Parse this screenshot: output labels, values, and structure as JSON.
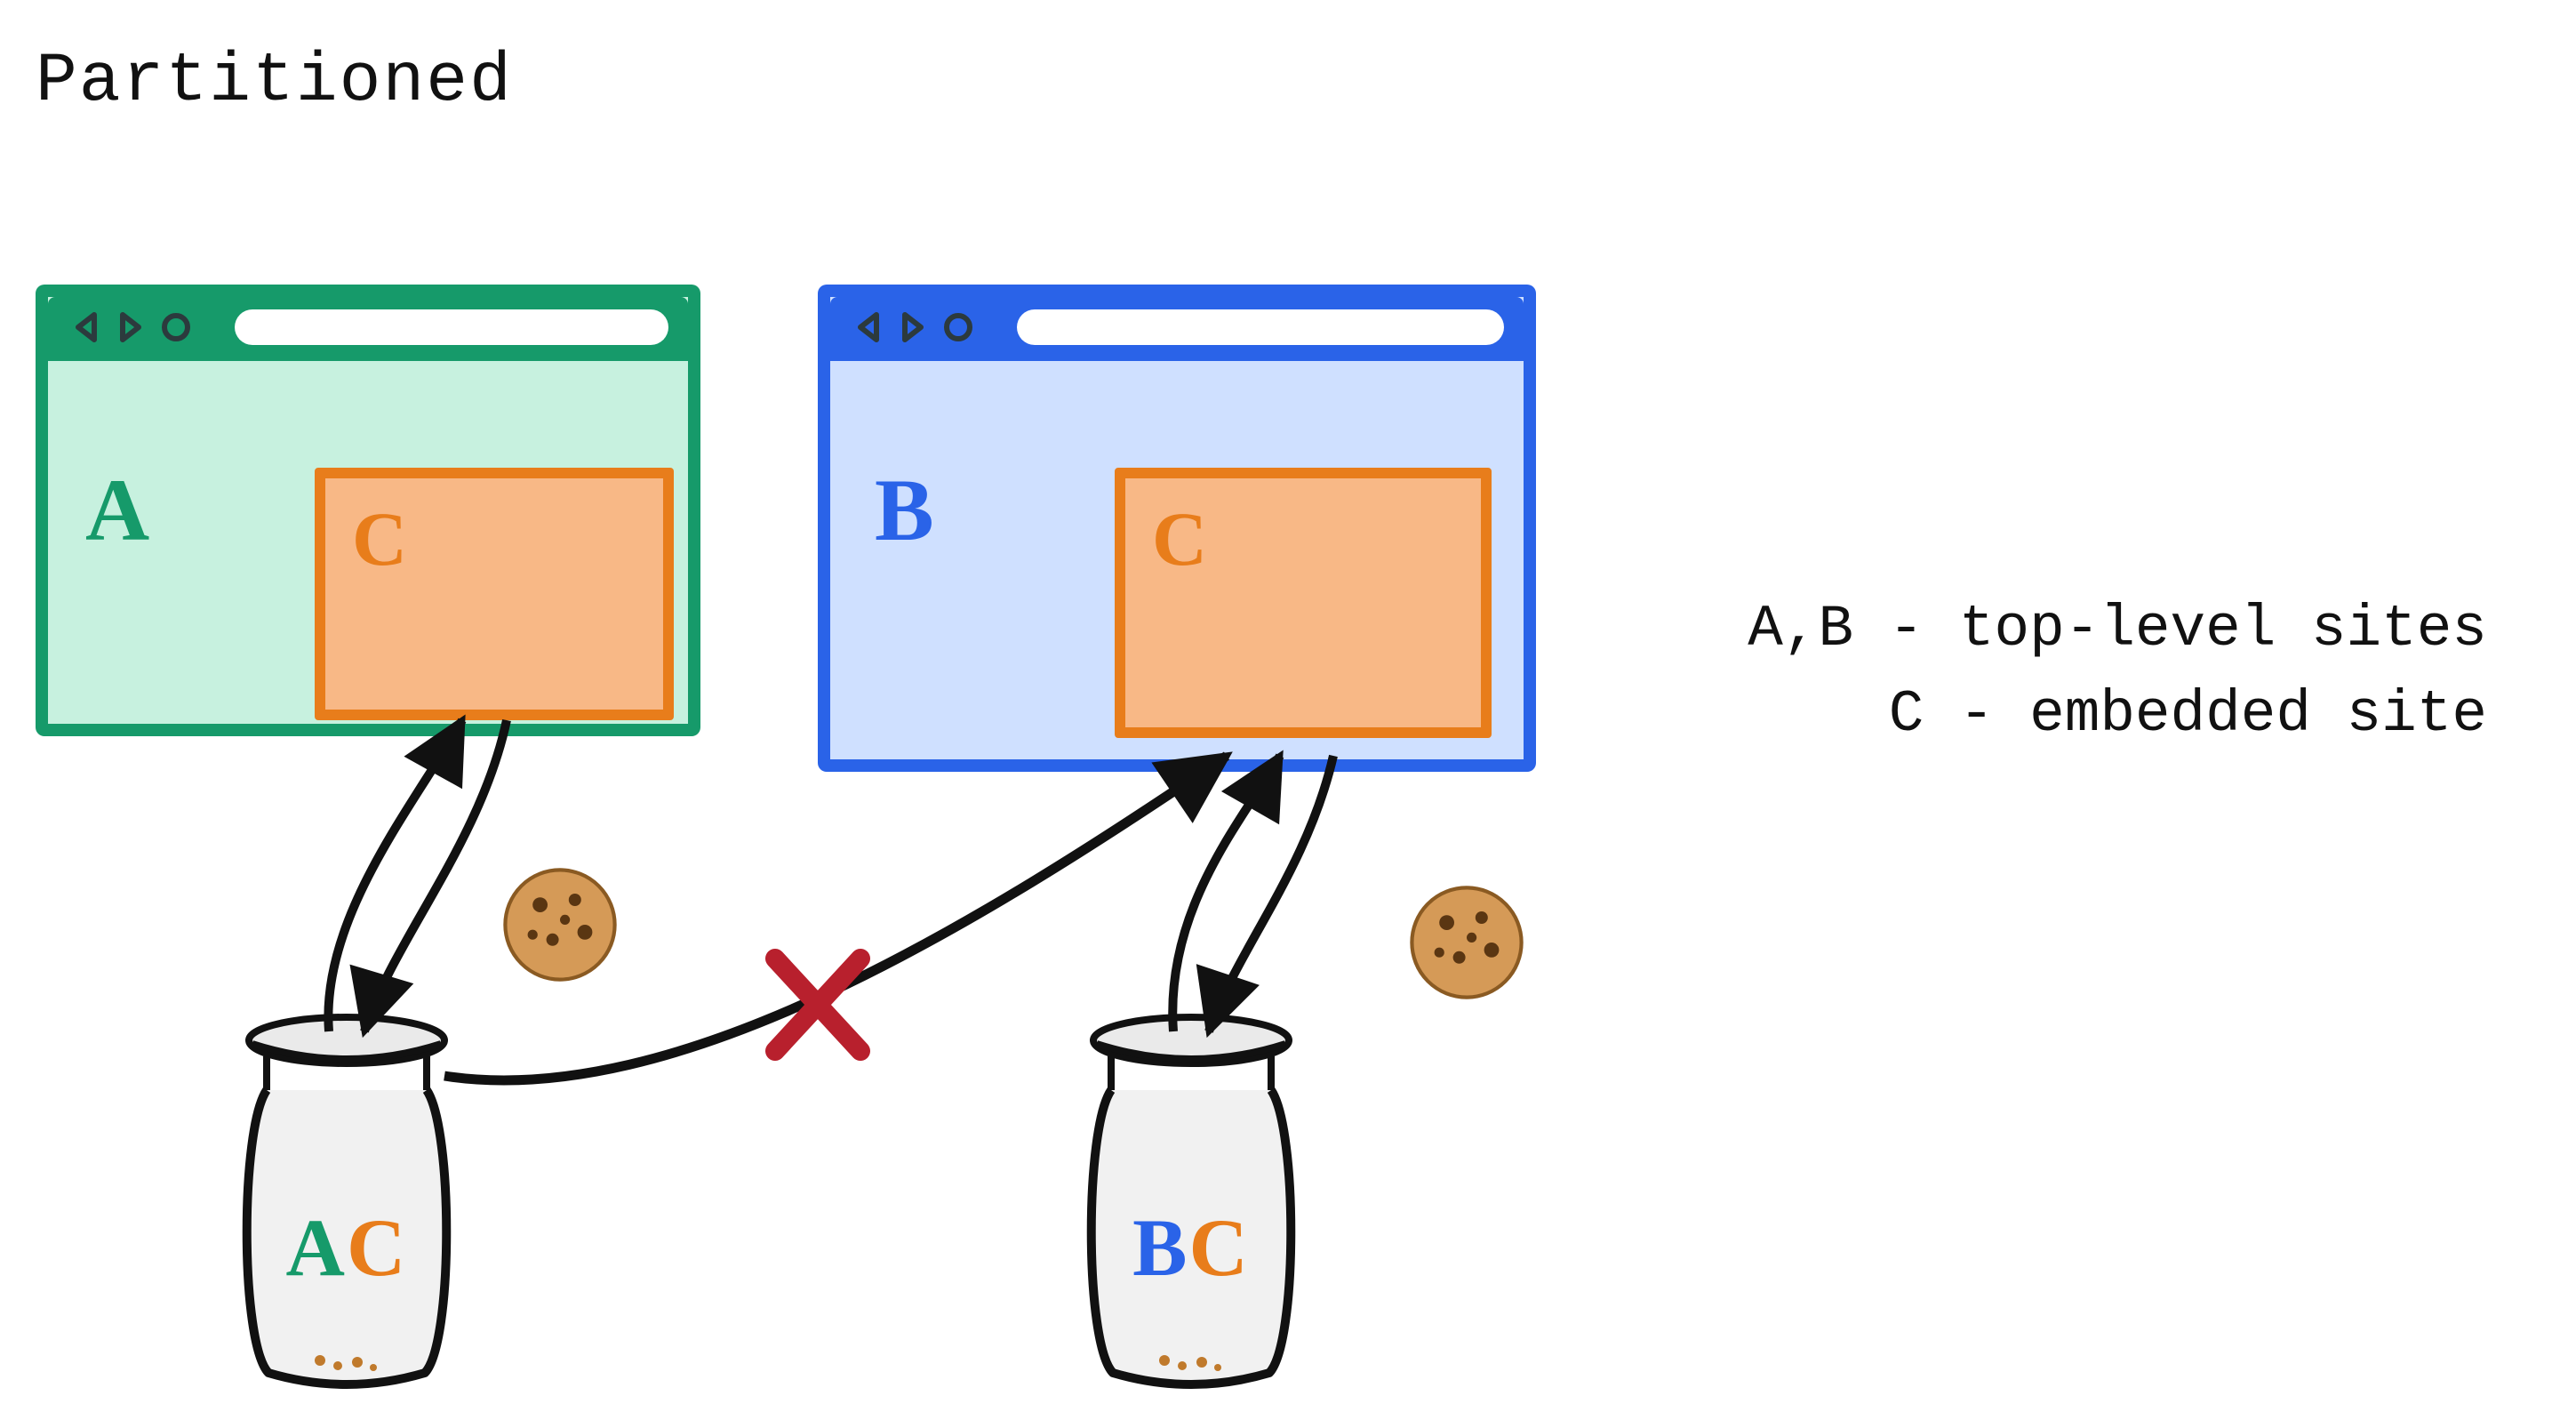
{
  "title": "Partitioned",
  "legend": {
    "line1": "A,B - top-level sites",
    "line2": "C - embedded site"
  },
  "windows": {
    "A": {
      "siteLabel": "A",
      "embedLabel": "C",
      "color": "#169a6a"
    },
    "B": {
      "siteLabel": "B",
      "embedLabel": "C",
      "color": "#2a63e8"
    }
  },
  "jars": {
    "A": {
      "part1": "A",
      "part2": "C"
    },
    "B": {
      "part1": "B",
      "part2": "C"
    }
  },
  "icons": {
    "cookieA": "cookie-icon",
    "cookieB": "cookie-icon"
  },
  "blocked": {
    "symbol": "X"
  },
  "colors": {
    "siteA": "#169a6a",
    "siteB": "#2a63e8",
    "embedC": "#e87d1b",
    "embedFill": "#f8b886",
    "cookie": "#c98849",
    "chip": "#6a3b12",
    "blocked": "#b8202d",
    "stroke": "#111111"
  }
}
